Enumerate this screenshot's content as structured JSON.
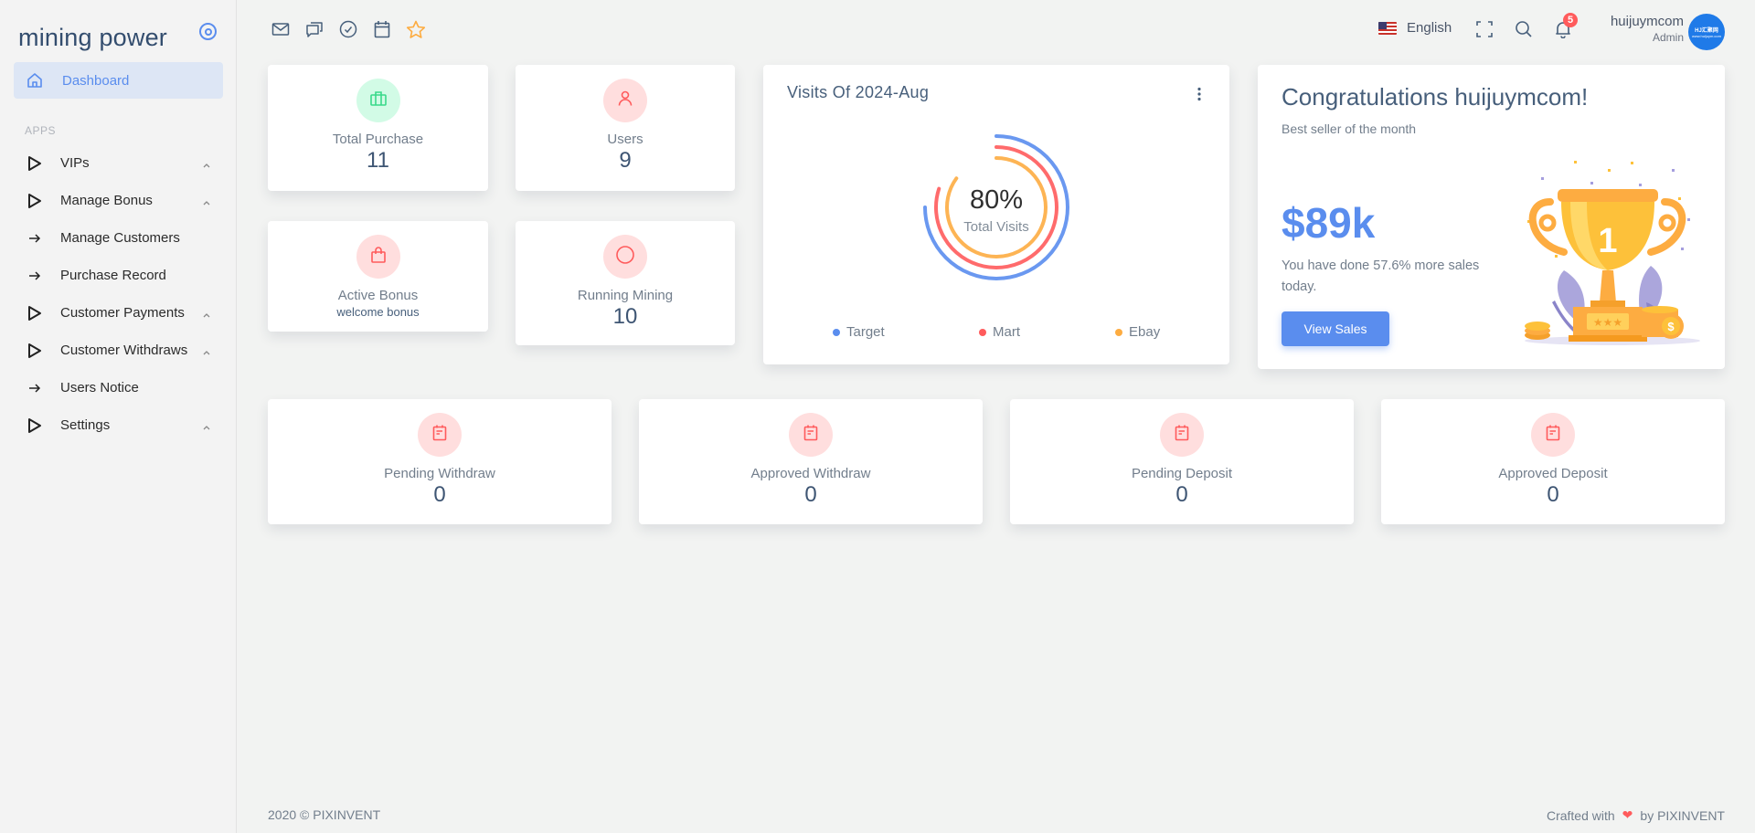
{
  "sidebar": {
    "brand": "mining power",
    "active_item": {
      "label": "Dashboard",
      "icon": "home-icon"
    },
    "section_label": "APPS",
    "items": [
      {
        "label": "VIPs",
        "icon": "play-outline-icon",
        "expandable": true
      },
      {
        "label": "Manage Bonus",
        "icon": "play-outline-icon",
        "expandable": true
      },
      {
        "label": "Manage Customers",
        "icon": "arrow-right-icon",
        "expandable": false
      },
      {
        "label": "Purchase Record",
        "icon": "arrow-right-icon",
        "expandable": false
      },
      {
        "label": "Customer Payments",
        "icon": "play-outline-icon",
        "expandable": true
      },
      {
        "label": "Customer Withdraws",
        "icon": "play-outline-icon",
        "expandable": true
      },
      {
        "label": "Users Notice",
        "icon": "arrow-right-icon",
        "expandable": false
      },
      {
        "label": "Settings",
        "icon": "play-outline-icon",
        "expandable": true
      }
    ]
  },
  "topbar": {
    "shortcut_icons": [
      "mail-icon",
      "chat-icon",
      "check-circle-icon",
      "calendar-icon",
      "star-icon"
    ],
    "language": "English",
    "notification_count": "5",
    "user": {
      "name": "huijuymcom",
      "role": "Admin",
      "avatar_text": "HJ汇聚网",
      "avatar_subtext": "www.huijuym.com"
    }
  },
  "stats_top": [
    {
      "title": "Total Purchase",
      "value": "11",
      "icon": "briefcase-icon",
      "tone": "green"
    },
    {
      "title": "Users",
      "value": "9",
      "icon": "user-icon",
      "tone": "red"
    },
    {
      "title": "Active Bonus",
      "sub": "welcome bonus",
      "icon": "shopping-bag-icon",
      "tone": "red"
    },
    {
      "title": "Running Mining",
      "value": "10",
      "icon": "circle-icon",
      "tone": "red"
    }
  ],
  "visits": {
    "title": "Visits Of 2024-Aug",
    "center_value": "80%",
    "center_label": "Total Visits"
  },
  "chart_data": {
    "type": "radialBar",
    "title": "Visits Of 2024-Aug",
    "categories": [
      "Target",
      "Mart",
      "Ebay"
    ],
    "values": [
      75,
      80,
      85
    ],
    "unit": "%",
    "colors": [
      "#5a8dee",
      "#ff5b5c",
      "#fdac41"
    ],
    "center_value": "80%",
    "center_label": "Total Visits",
    "legend_position": "bottom"
  },
  "congrats": {
    "title": "Congratulations huijuymcom!",
    "subtitle": "Best seller of the month",
    "amount": "$89k",
    "description": "You have done 57.6% more sales today.",
    "button": "View Sales",
    "trophy_number": "1"
  },
  "stats_bottom": [
    {
      "title": "Pending Withdraw",
      "value": "0",
      "icon": "notepad-icon"
    },
    {
      "title": "Approved Withdraw",
      "value": "0",
      "icon": "notepad-icon"
    },
    {
      "title": "Pending Deposit",
      "value": "0",
      "icon": "notepad-icon"
    },
    {
      "title": "Approved Deposit",
      "value": "0",
      "icon": "notepad-icon"
    }
  ],
  "footer": {
    "left": "2020 © PIXINVENT",
    "right_prefix": "Crafted with",
    "right_suffix": "by PIXINVENT"
  },
  "colors": {
    "primary": "#5a8dee",
    "danger": "#ff5b5c",
    "warning": "#fdac41",
    "success": "#39da8a"
  }
}
